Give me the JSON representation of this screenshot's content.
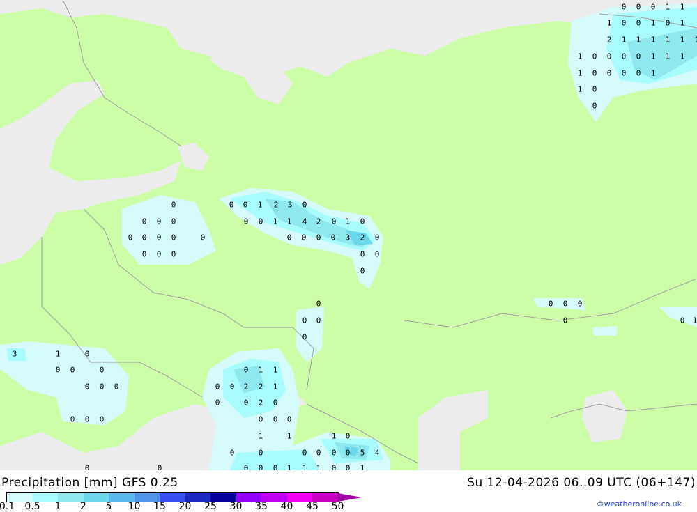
{
  "title": "Precipitation [mm] GFS 0.25",
  "datetime": "Su 12-04-2026 06..09 UTC (06+147)",
  "credit": "©weatheronline.co.uk",
  "legend": {
    "ticks": [
      "0.1",
      "0.5",
      "1",
      "2",
      "5",
      "10",
      "15",
      "20",
      "25",
      "30",
      "35",
      "40",
      "45",
      "50"
    ],
    "colors": [
      "#d4fafa",
      "#a8fcfc",
      "#8ee8ee",
      "#6cd8ec",
      "#5cb8ec",
      "#5094ec",
      "#3850f0",
      "#1c28c0",
      "#0a009c",
      "#9400f8",
      "#c000f0",
      "#f400f4",
      "#c800c0"
    ]
  },
  "map_colors": {
    "land": "#ccfea8",
    "sea": "#ececec",
    "border": "#a0a0a0"
  },
  "values": [
    "0",
    "0",
    "1",
    "2",
    "3",
    "0",
    "0",
    "0",
    "1",
    "1",
    "4",
    "2",
    "0",
    "1",
    "0",
    "0",
    "0",
    "0",
    "0",
    "3",
    "2",
    "0",
    "0",
    "0",
    "0",
    "0",
    "0",
    "0",
    "0",
    "0",
    "0",
    "0",
    "0",
    "0",
    "0",
    "0",
    "0",
    "0",
    "0",
    "0",
    "0",
    "0",
    "0",
    "0",
    "1",
    "1",
    "1",
    "0",
    "0",
    "1",
    "0",
    "1",
    "2",
    "1",
    "1",
    "1",
    "1",
    "1",
    "1",
    "1",
    "0",
    "0",
    "0",
    "0",
    "1",
    "1",
    "1",
    "1",
    "0",
    "0",
    "0",
    "0",
    "1",
    "1",
    "0",
    "0",
    "0",
    "0",
    "0",
    "0",
    "0",
    "1",
    "3",
    "1",
    "0",
    "0",
    "0",
    "0",
    "0",
    "0",
    "0",
    "0",
    "0",
    "0",
    "0",
    "1",
    "1",
    "0",
    "0",
    "2",
    "2",
    "1",
    "0",
    "0",
    "2",
    "0",
    "0",
    "0",
    "0",
    "1",
    "1",
    "1",
    "0",
    "0",
    "0",
    "0",
    "0",
    "0",
    "0",
    "5",
    "4",
    "0",
    "0",
    "0",
    "1",
    "1",
    "1",
    "0",
    "0",
    "1",
    "0",
    "0",
    "0"
  ]
}
